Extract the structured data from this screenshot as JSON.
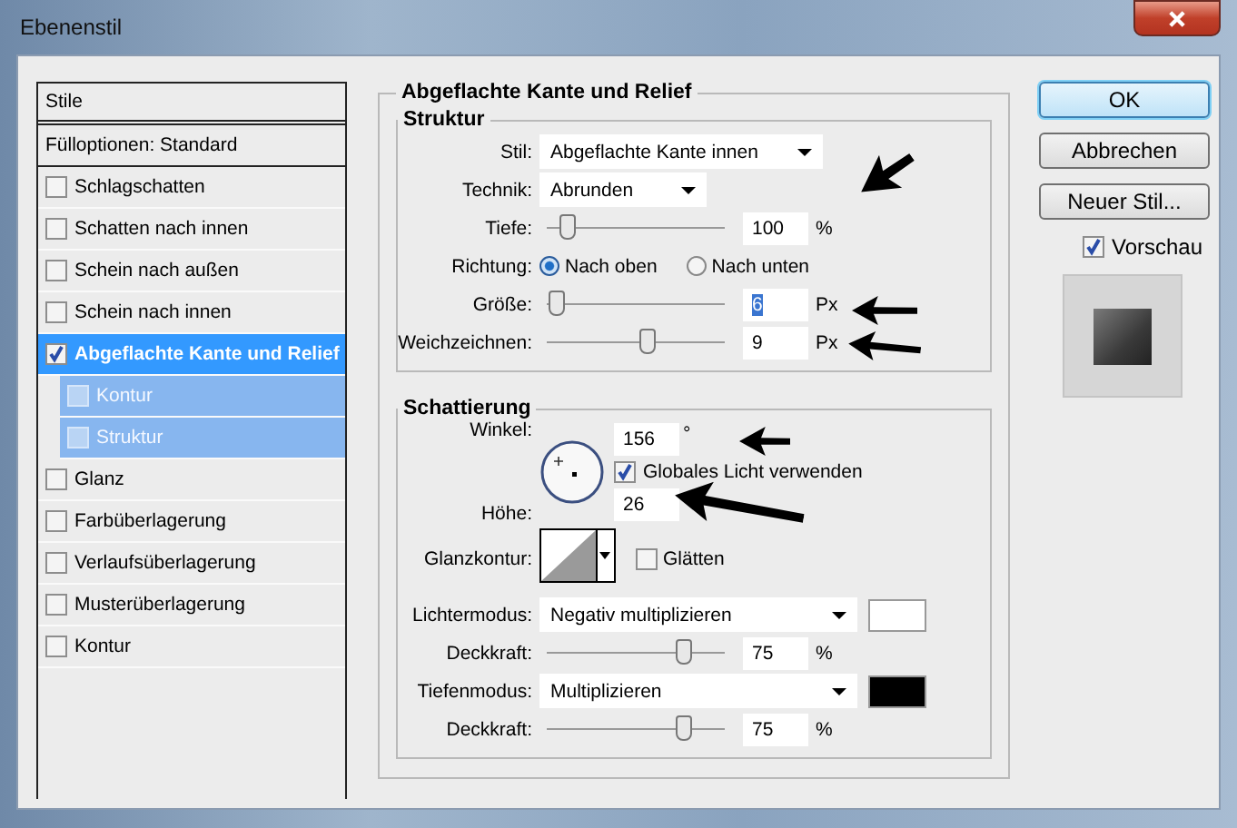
{
  "window": {
    "title": "Ebenenstil"
  },
  "styles_list": {
    "header": "Stile",
    "blend_options": "Fülloptionen: Standard",
    "items": [
      {
        "label": "Schlagschatten",
        "checked": false,
        "selected": false
      },
      {
        "label": "Schatten nach innen",
        "checked": false,
        "selected": false
      },
      {
        "label": "Schein nach außen",
        "checked": false,
        "selected": false
      },
      {
        "label": "Schein nach innen",
        "checked": false,
        "selected": false
      },
      {
        "label": "Abgeflachte Kante und Relief",
        "checked": true,
        "selected": true,
        "children": [
          {
            "label": "Kontur",
            "checked": false
          },
          {
            "label": "Struktur",
            "checked": false
          }
        ]
      },
      {
        "label": "Glanz",
        "checked": false,
        "selected": false
      },
      {
        "label": "Farbüberlagerung",
        "checked": false,
        "selected": false
      },
      {
        "label": "Verlaufsüberlagerung",
        "checked": false,
        "selected": false
      },
      {
        "label": "Musterüberlagerung",
        "checked": false,
        "selected": false
      },
      {
        "label": "Kontur",
        "checked": false,
        "selected": false
      }
    ]
  },
  "bevel": {
    "title": "Abgeflachte Kante und Relief",
    "structure": {
      "title": "Struktur",
      "rows": [
        {
          "kind": "select",
          "label": "Stil:",
          "value": "Abgeflachte Kante innen"
        },
        {
          "kind": "select",
          "label": "Technik:",
          "value": "Abrunden"
        },
        {
          "kind": "slider",
          "label": "Tiefe:",
          "level": 0.1,
          "value": "100",
          "unit": "%",
          "text_selected": false
        },
        {
          "kind": "radio",
          "label": "Richtung:",
          "options": [
            {
              "label": "Nach oben",
              "selected": true
            },
            {
              "label": "Nach unten",
              "selected": false
            }
          ]
        },
        {
          "kind": "slider",
          "label": "Größe:",
          "level": 0.04,
          "value": "6",
          "unit": "Px",
          "text_selected": true
        },
        {
          "kind": "slider",
          "label": "Weichzeichnen:",
          "level": 0.55,
          "value": "9",
          "unit": "Px",
          "text_selected": false
        }
      ]
    },
    "shading": {
      "title": "Schattierung",
      "angle_label": "Winkel:",
      "angle": "156",
      "angle_unit": "°",
      "global_light": {
        "label": "Globales Licht verwenden",
        "checked": true
      },
      "altitude_label": "Höhe:",
      "altitude": "26",
      "gloss_label": "Glanzkontur:",
      "antialias": {
        "label": "Glätten",
        "checked": false
      },
      "rows": [
        {
          "kind": "mode",
          "label": "Lichtermodus:",
          "value": "Negativ multiplizieren",
          "color": "#ffffff"
        },
        {
          "kind": "slider",
          "label": "Deckkraft:",
          "level": 0.75,
          "value": "75",
          "unit": "%",
          "text_selected": false
        },
        {
          "kind": "mode",
          "label": "Tiefenmodus:",
          "value": "Multiplizieren",
          "color": "#000000"
        },
        {
          "kind": "slider",
          "label": "Deckkraft:",
          "level": 0.75,
          "value": "75",
          "unit": "%",
          "text_selected": false
        }
      ]
    }
  },
  "buttons": [
    {
      "label": "OK",
      "default": true
    },
    {
      "label": "Abbrechen",
      "default": false
    },
    {
      "label": "Neuer Stil...",
      "default": false
    }
  ],
  "preview": {
    "label": "Vorschau",
    "checked": true
  }
}
